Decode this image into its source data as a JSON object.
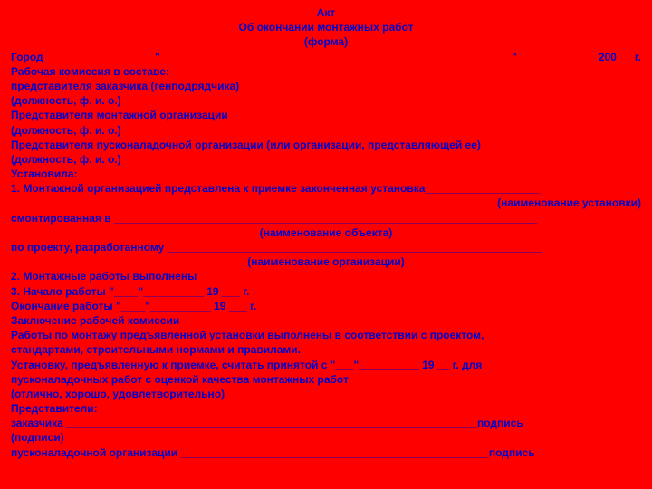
{
  "title1": "Акт",
  "title2": "Об окончании монтажных работ",
  "title3": "(форма)",
  "g_city": "Город __________________\"",
  "g_date": "\"_____________ 200 __ г.",
  "l1": "Рабочая комиссия в составе:",
  "l2": "представителя заказчика (генподрядчика) ________________________________________________",
  "l3": "(должность, ф. и. о.)",
  "l4": "Представителя монтажной организации_________________________________________________",
  "l5": "(должность, ф. и. о.)",
  "l6": "Представителя пусконаладочной организации (или организации, представляющей ее)",
  "l7": "(должность, ф. и. о.)",
  "l8": "Установила:",
  "l9": "1. Монтажной организацией представлена к приемке законченная установка___________________",
  "l10": "(наименование установки)",
  "l11": "смонтированная в ______________________________________________________________________",
  "l12": "(наименование объекта)",
  "l13": "по проекту, разработанному ______________________________________________________________",
  "l14": "(наименование организации)",
  "l15": "2. Монтажные работы выполнены",
  "l16": "3. Начало работы \"____\"__________ 19 ___ г.",
  "l17": "Окончание работы \"____\"__________ 19 ___ г.",
  "l18": "Заключение рабочей комиссии",
  "l19": "Работы по монтажу предъявленной установки выполнены в соответствии с проектом,",
  "l20": "стандартами, строительными нормами и правилами.",
  "l21": "Установку, предъявленную к приемке, считать принятой с \"___\"__________ 19 __ г. для",
  "l22": "пусконаладочных работ с оценкой качества монтажных работ",
  "l23": "(отлично, хорошо, удовлетворительно)",
  "l24": "Представители:",
  "l25": "заказчика ____________________________________________________________________подпись",
  "l26": "(подписи)",
  "l27": "пусконаладочной организации ___________________________________________________подпись"
}
